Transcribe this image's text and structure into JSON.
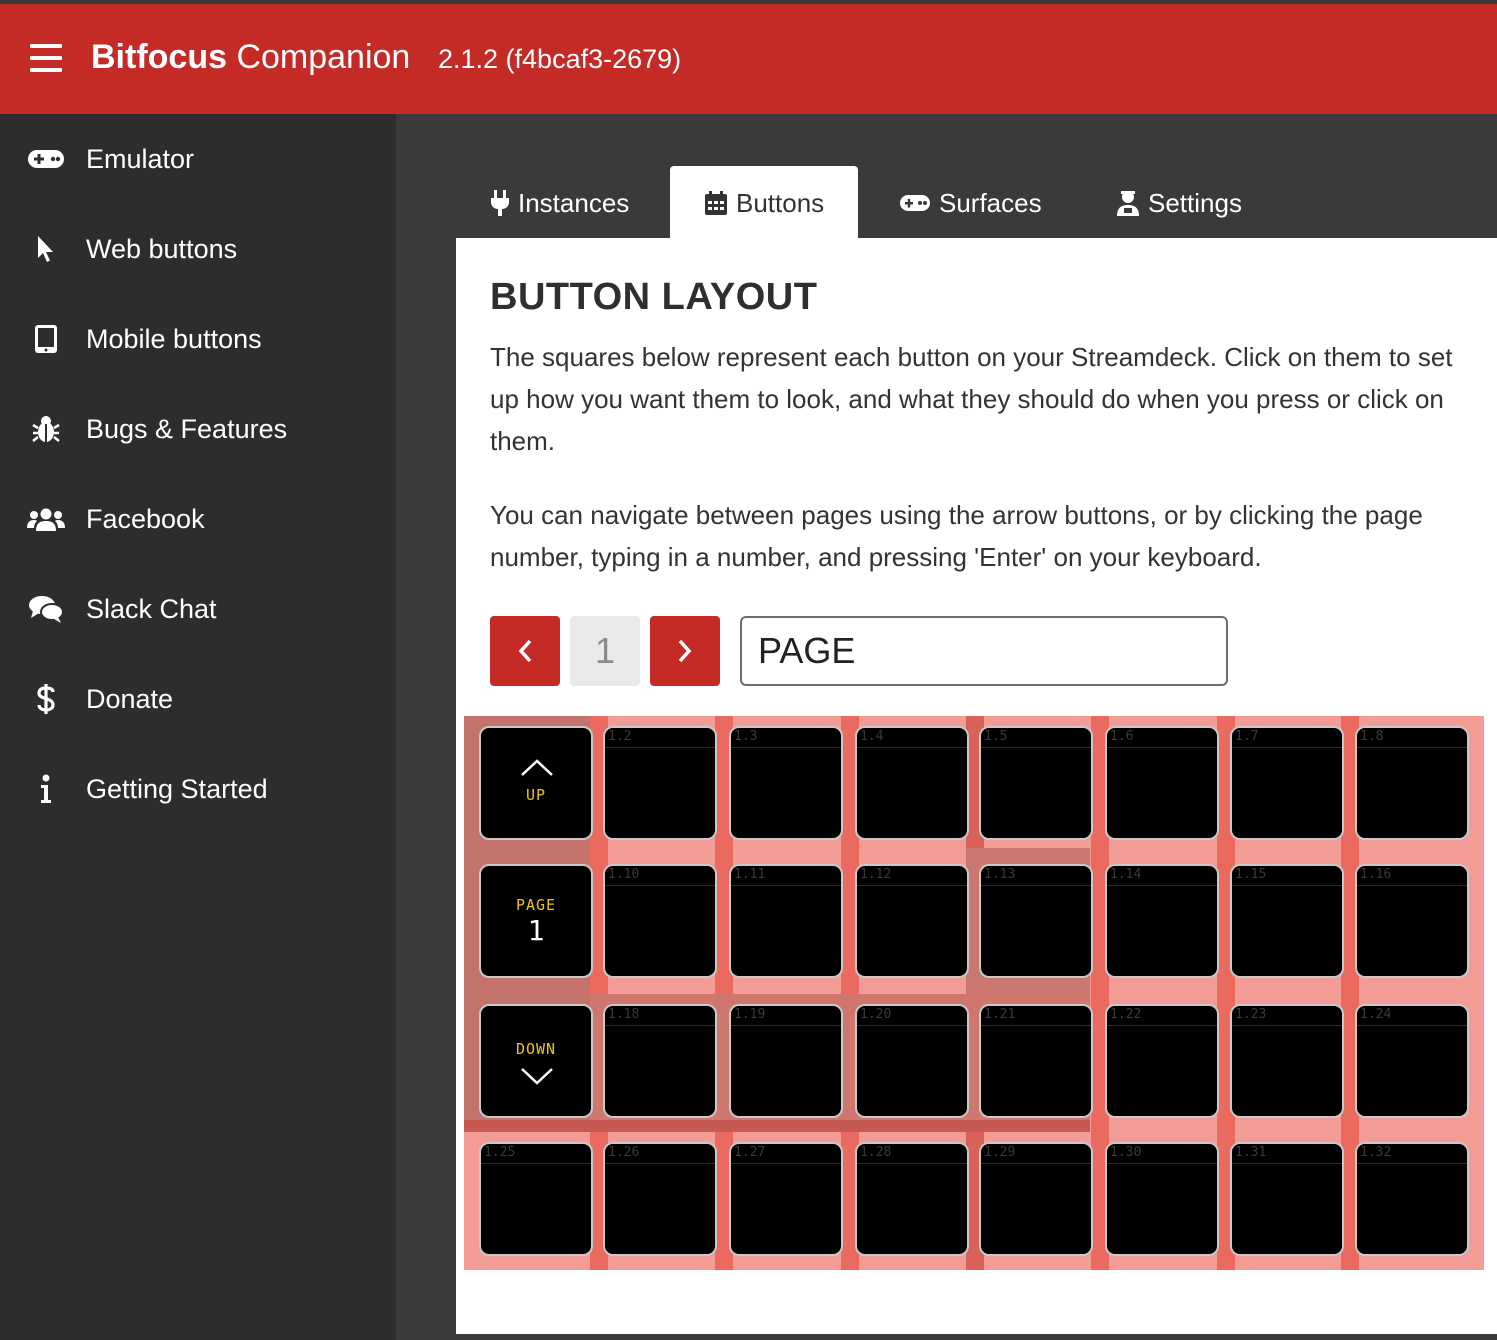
{
  "header": {
    "brand_bold": "Bitfocus",
    "brand_rest": " Companion",
    "version": "2.1.2 (f4bcaf3-2679)"
  },
  "sidebar": {
    "items": [
      {
        "label": "Emulator",
        "icon": "gamepad-icon"
      },
      {
        "label": "Web buttons",
        "icon": "pointer-icon"
      },
      {
        "label": "Mobile buttons",
        "icon": "tablet-icon"
      },
      {
        "label": "Bugs & Features",
        "icon": "bug-icon"
      },
      {
        "label": "Facebook",
        "icon": "users-icon"
      },
      {
        "label": "Slack Chat",
        "icon": "chat-icon"
      },
      {
        "label": "Donate",
        "icon": "dollar-icon"
      },
      {
        "label": "Getting Started",
        "icon": "info-icon"
      }
    ]
  },
  "tabs": [
    {
      "label": "Instances",
      "icon": "plug-icon"
    },
    {
      "label": "Buttons",
      "icon": "calendar-icon"
    },
    {
      "label": "Surfaces",
      "icon": "gamepad-icon"
    },
    {
      "label": "Settings",
      "icon": "user-cog-icon"
    }
  ],
  "panel": {
    "title": "BUTTON LAYOUT",
    "para1": "The squares below represent each button on your Streamdeck. Click on them to set up how you want them to look, and what they should do when you press or click on them.",
    "para2": "You can navigate between pages using the arrow buttons, or by clicking the page number, typing in a number, and pressing 'Enter' on your keyboard."
  },
  "pager": {
    "page_number": "1",
    "page_name": "PAGE"
  },
  "grid": {
    "up_label": "UP",
    "page_label": "PAGE",
    "page_value": "1",
    "down_label": "DOWN",
    "key_labels": [
      "",
      "1.2",
      "1.3",
      "1.4",
      "1.5",
      "1.6",
      "1.7",
      "1.8",
      "",
      "1.10",
      "1.11",
      "1.12",
      "1.13",
      "1.14",
      "1.15",
      "1.16",
      "",
      "1.18",
      "1.19",
      "1.20",
      "1.21",
      "1.22",
      "1.23",
      "1.24",
      "1.25",
      "1.26",
      "1.27",
      "1.28",
      "1.29",
      "1.30",
      "1.31",
      "1.32"
    ]
  },
  "colors": {
    "brand_red": "#c42a26",
    "sidebar_bg": "#2d2d2d",
    "key_text": "#f0c419"
  }
}
